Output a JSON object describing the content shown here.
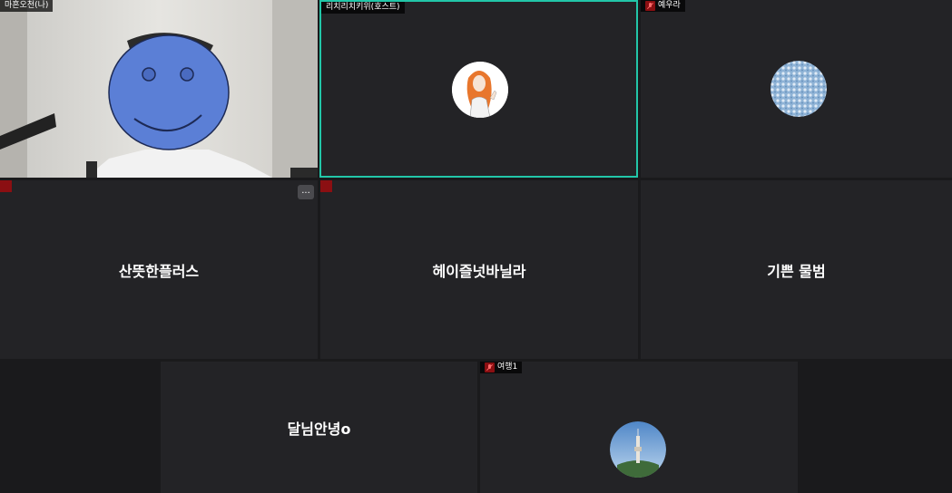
{
  "participants": [
    {
      "name": "마흔오천(나)",
      "type": "video"
    },
    {
      "name": "리치리치키위(호스트)",
      "type": "avatar",
      "avatar_icon": "woman-illustration-icon",
      "active_speaker": true
    },
    {
      "name": "예우라",
      "type": "avatar",
      "avatar_icon": "sky-texture-icon",
      "muted": true
    },
    {
      "name": "산뜻한플러스",
      "type": "name",
      "muted": true,
      "more_label": "..."
    },
    {
      "name": "헤이즐넛바닐라",
      "type": "name",
      "muted": true
    },
    {
      "name": "기쁜 물범",
      "type": "name"
    },
    {
      "name": "달님안녕o",
      "type": "name"
    },
    {
      "name": "여행1",
      "type": "avatar",
      "avatar_icon": "tower-landscape-icon",
      "muted": true
    }
  ],
  "colors": {
    "active_border": "#22c6a8",
    "tile_bg": "#232326",
    "mute_red": "#8b0f12",
    "face_blue": "#5b7fd6"
  }
}
